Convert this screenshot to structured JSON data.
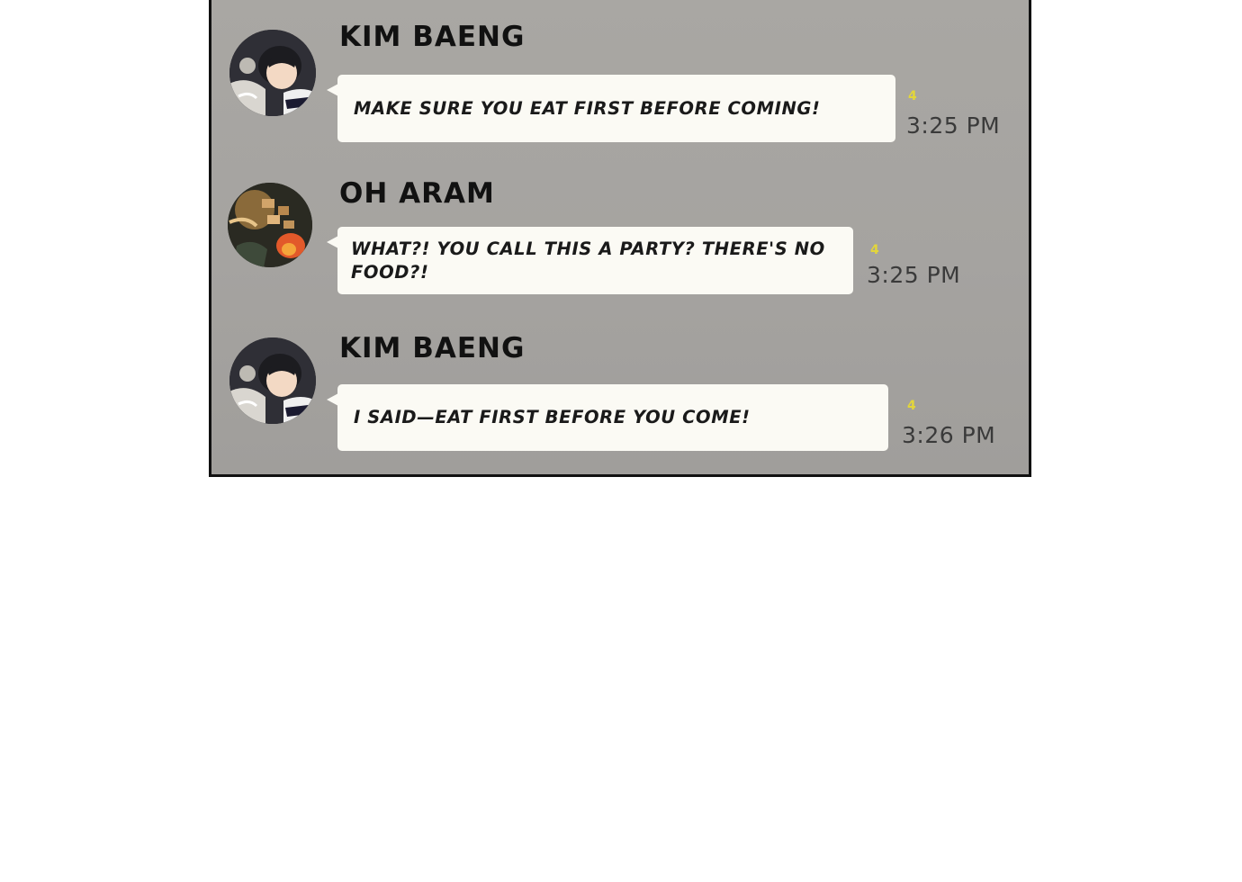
{
  "messages": [
    {
      "sender": "KIM BAENG",
      "avatar": "kim-baeng-avatar",
      "text": "MAKE SURE YOU EAT FIRST BEFORE COMING!",
      "unread": "4",
      "time": "3:25 PM"
    },
    {
      "sender": "OH ARAM",
      "avatar": "oh-aram-avatar",
      "text": "WHAT?! YOU CALL THIS A PARTY? THERE'S NO FOOD?!",
      "unread": "4",
      "time": "3:25 PM"
    },
    {
      "sender": "KIM BAENG",
      "avatar": "kim-baeng-avatar",
      "text": "I SAID—EAT FIRST BEFORE YOU COME!",
      "unread": "4",
      "time": "3:26 PM"
    }
  ],
  "colors": {
    "panel_background": "#a7a5a2",
    "bubble": "#fbfaf4",
    "unread_count": "#e3d63a",
    "timestamp": "#3a3a3a"
  }
}
